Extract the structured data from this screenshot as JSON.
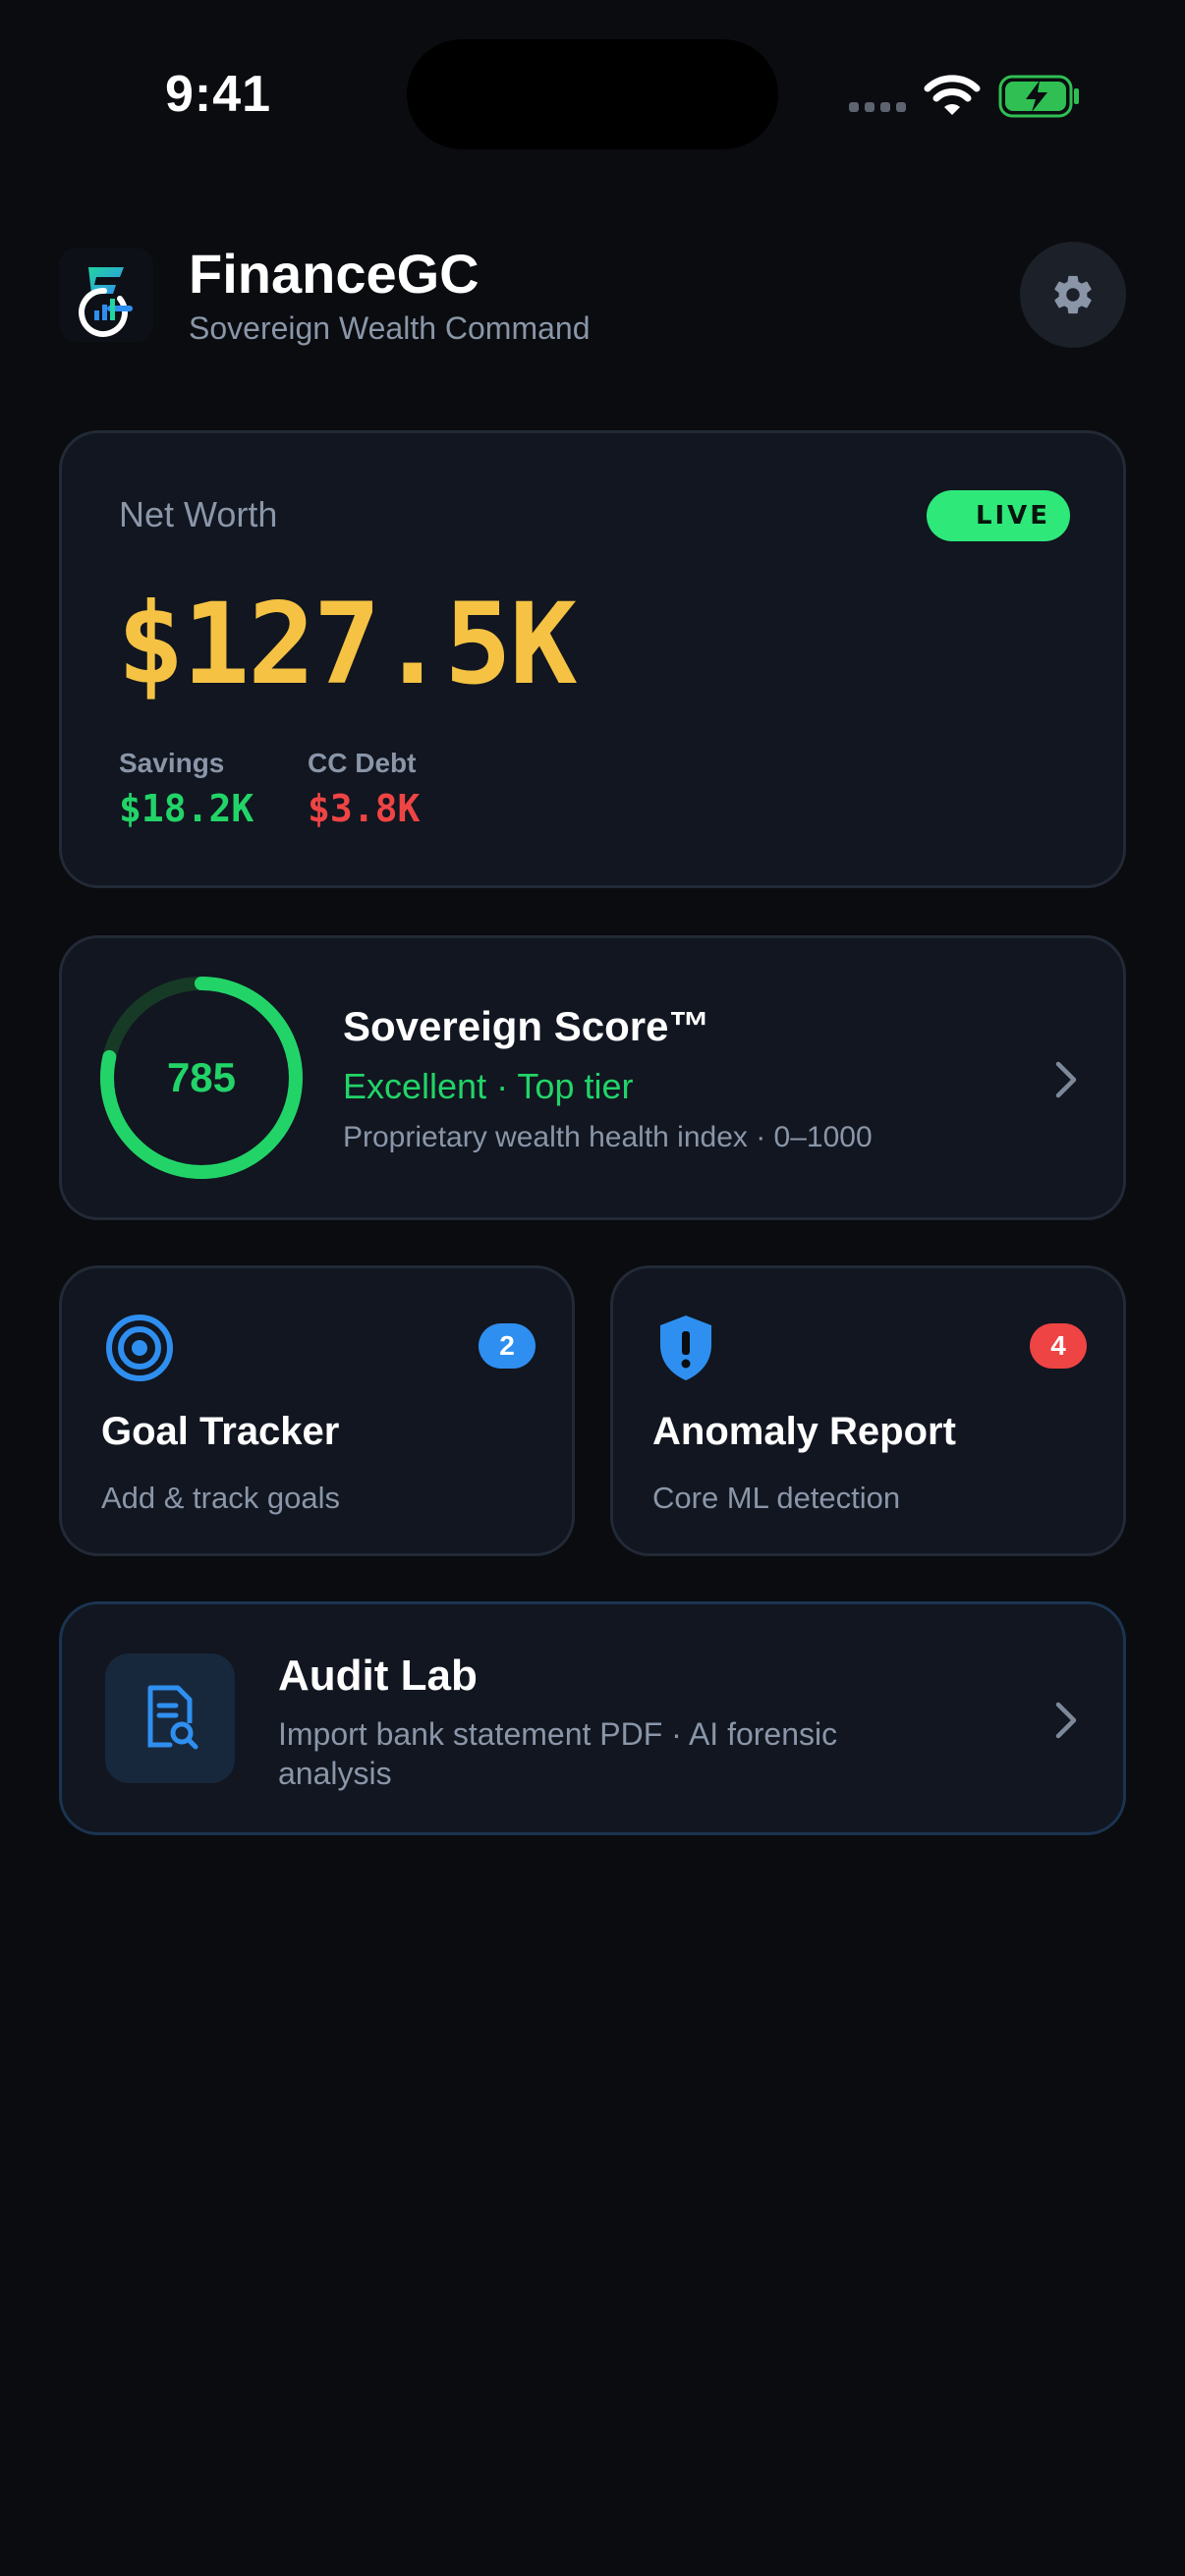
{
  "status_bar": {
    "time": "9:41",
    "signal_icon": "cellular-dots-icon",
    "wifi_icon": "wifi-icon",
    "battery_icon": "battery-charging-icon"
  },
  "header": {
    "logo_icon": "financegc-logo-icon",
    "title": "FinanceGC",
    "subtitle": "Sovereign Wealth Command",
    "settings_icon": "gear-icon"
  },
  "net_worth": {
    "label": "Net Worth",
    "live_badge": "LIVE",
    "value": "$127.5K",
    "savings_label": "Savings",
    "savings_value": "$18.2K",
    "debt_label": "CC Debt",
    "debt_value": "$3.8K"
  },
  "score": {
    "value": "785",
    "progress_fraction": 0.785,
    "title": "Sovereign Score™",
    "status": "Excellent · Top tier",
    "description": "Proprietary wealth health index · 0–1000"
  },
  "goal_tracker": {
    "icon": "target-icon",
    "badge": "2",
    "title": "Goal Tracker",
    "subtitle": "Add & track goals"
  },
  "anomaly_report": {
    "icon": "shield-alert-icon",
    "badge": "4",
    "title": "Anomaly Report",
    "subtitle": "Core ML detection"
  },
  "audit_lab": {
    "icon": "document-search-icon",
    "title": "Audit Lab",
    "description": "Import bank statement PDF · AI forensic analysis"
  },
  "colors": {
    "background": "#0a0c10",
    "card": "#111620",
    "gold": "#f5c243",
    "green": "#22d468",
    "red": "#ef4444",
    "blue": "#2f8ff0",
    "muted": "#8a96a8"
  }
}
